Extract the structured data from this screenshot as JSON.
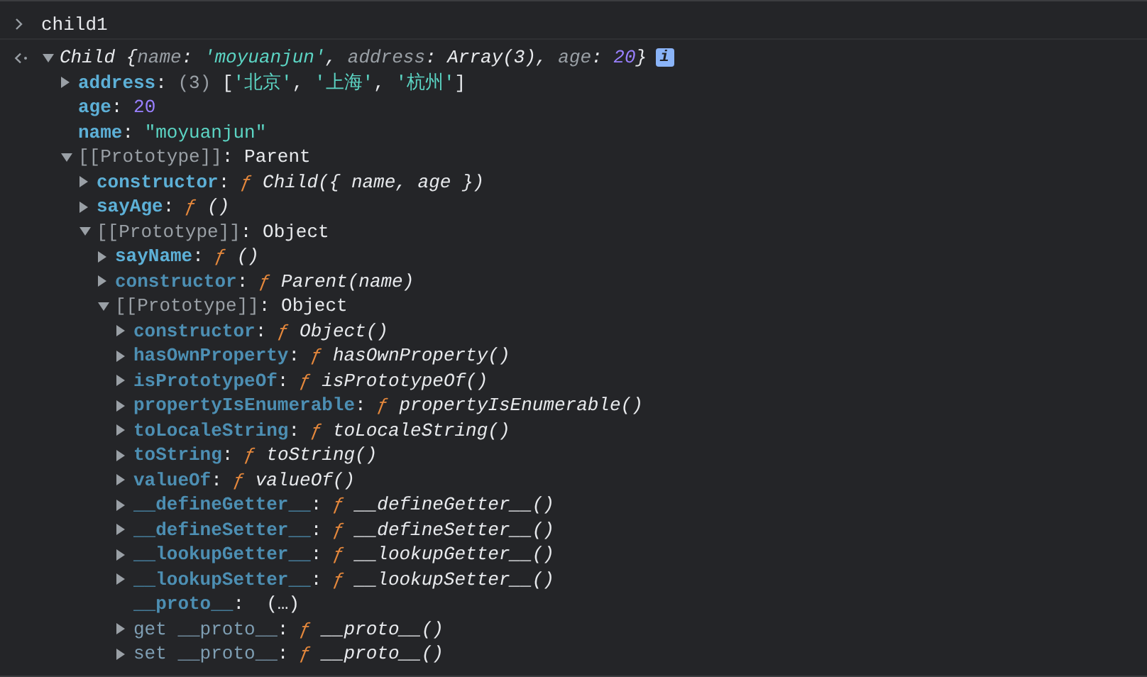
{
  "input": {
    "command": "child1"
  },
  "result": {
    "expanded": true,
    "badge": "i",
    "parts": [
      {
        "kind": "italic",
        "text": "Child "
      },
      {
        "kind": "text",
        "text": "{"
      },
      {
        "kind": "dim",
        "text": "name"
      },
      {
        "kind": "text",
        "text": ": "
      },
      {
        "kind": "string",
        "text": "'moyuanjun'"
      },
      {
        "kind": "text",
        "text": ", "
      },
      {
        "kind": "dim",
        "text": "address"
      },
      {
        "kind": "text",
        "text": ": "
      },
      {
        "kind": "italic",
        "text": "Array(3)"
      },
      {
        "kind": "text",
        "text": ", "
      },
      {
        "kind": "dim",
        "text": "age"
      },
      {
        "kind": "text",
        "text": ": "
      },
      {
        "kind": "number",
        "text": "20"
      },
      {
        "kind": "text",
        "text": "}"
      }
    ],
    "children": [
      {
        "expanded": false,
        "key": "address",
        "kind": "own",
        "parts": [
          {
            "kind": "text",
            "text": ": "
          },
          {
            "kind": "dim",
            "text": "(3) "
          },
          {
            "kind": "text",
            "text": "["
          },
          {
            "kind": "string",
            "text": "'北京'"
          },
          {
            "kind": "text",
            "text": ", "
          },
          {
            "kind": "string",
            "text": "'上海'"
          },
          {
            "kind": "text",
            "text": ", "
          },
          {
            "kind": "string",
            "text": "'杭州'"
          },
          {
            "kind": "text",
            "text": "]"
          }
        ]
      },
      {
        "key": "age",
        "kind": "own",
        "parts": [
          {
            "kind": "text",
            "text": ": "
          },
          {
            "kind": "number",
            "text": "20"
          }
        ]
      },
      {
        "key": "name",
        "kind": "own",
        "parts": [
          {
            "kind": "text",
            "text": ": "
          },
          {
            "kind": "string",
            "text": "\"moyuanjun\""
          }
        ]
      },
      {
        "expanded": true,
        "key": "[[Prototype]]",
        "kind": "internal",
        "parts": [
          {
            "kind": "text",
            "text": ": Parent"
          }
        ],
        "children": [
          {
            "expanded": false,
            "key": "constructor",
            "kind": "own",
            "parts": [
              {
                "kind": "text",
                "text": ": "
              },
              {
                "kind": "func",
                "text": "ƒ "
              },
              {
                "kind": "italic",
                "text": "Child({ name, age })"
              }
            ]
          },
          {
            "expanded": false,
            "key": "sayAge",
            "kind": "own",
            "parts": [
              {
                "kind": "text",
                "text": ": "
              },
              {
                "kind": "func",
                "text": "ƒ "
              },
              {
                "kind": "italic",
                "text": "()"
              }
            ]
          },
          {
            "expanded": true,
            "key": "[[Prototype]]",
            "kind": "internal",
            "parts": [
              {
                "kind": "text",
                "text": ": Object"
              }
            ],
            "children": [
              {
                "expanded": false,
                "key": "sayName",
                "kind": "own",
                "parts": [
                  {
                    "kind": "text",
                    "text": ": "
                  },
                  {
                    "kind": "func",
                    "text": "ƒ "
                  },
                  {
                    "kind": "italic",
                    "text": "()"
                  }
                ]
              },
              {
                "expanded": false,
                "key": "constructor",
                "kind": "inherited",
                "parts": [
                  {
                    "kind": "text",
                    "text": ": "
                  },
                  {
                    "kind": "func",
                    "text": "ƒ "
                  },
                  {
                    "kind": "italic",
                    "text": "Parent(name)"
                  }
                ]
              },
              {
                "expanded": true,
                "key": "[[Prototype]]",
                "kind": "internal",
                "parts": [
                  {
                    "kind": "text",
                    "text": ": Object"
                  }
                ],
                "children": [
                  {
                    "expanded": false,
                    "key": "constructor",
                    "kind": "inherited",
                    "parts": [
                      {
                        "kind": "text",
                        "text": ": "
                      },
                      {
                        "kind": "func",
                        "text": "ƒ "
                      },
                      {
                        "kind": "italic",
                        "text": "Object()"
                      }
                    ]
                  },
                  {
                    "expanded": false,
                    "key": "hasOwnProperty",
                    "kind": "inherited",
                    "parts": [
                      {
                        "kind": "text",
                        "text": ": "
                      },
                      {
                        "kind": "func",
                        "text": "ƒ "
                      },
                      {
                        "kind": "italic",
                        "text": "hasOwnProperty()"
                      }
                    ]
                  },
                  {
                    "expanded": false,
                    "key": "isPrototypeOf",
                    "kind": "inherited",
                    "parts": [
                      {
                        "kind": "text",
                        "text": ": "
                      },
                      {
                        "kind": "func",
                        "text": "ƒ "
                      },
                      {
                        "kind": "italic",
                        "text": "isPrototypeOf()"
                      }
                    ]
                  },
                  {
                    "expanded": false,
                    "key": "propertyIsEnumerable",
                    "kind": "inherited",
                    "parts": [
                      {
                        "kind": "text",
                        "text": ": "
                      },
                      {
                        "kind": "func",
                        "text": "ƒ "
                      },
                      {
                        "kind": "italic",
                        "text": "propertyIsEnumerable()"
                      }
                    ]
                  },
                  {
                    "expanded": false,
                    "key": "toLocaleString",
                    "kind": "inherited",
                    "parts": [
                      {
                        "kind": "text",
                        "text": ": "
                      },
                      {
                        "kind": "func",
                        "text": "ƒ "
                      },
                      {
                        "kind": "italic",
                        "text": "toLocaleString()"
                      }
                    ]
                  },
                  {
                    "expanded": false,
                    "key": "toString",
                    "kind": "inherited",
                    "parts": [
                      {
                        "kind": "text",
                        "text": ": "
                      },
                      {
                        "kind": "func",
                        "text": "ƒ "
                      },
                      {
                        "kind": "italic",
                        "text": "toString()"
                      }
                    ]
                  },
                  {
                    "expanded": false,
                    "key": "valueOf",
                    "kind": "inherited",
                    "parts": [
                      {
                        "kind": "text",
                        "text": ": "
                      },
                      {
                        "kind": "func",
                        "text": "ƒ "
                      },
                      {
                        "kind": "italic",
                        "text": "valueOf()"
                      }
                    ]
                  },
                  {
                    "expanded": false,
                    "key": "__defineGetter__",
                    "kind": "inherited",
                    "parts": [
                      {
                        "kind": "text",
                        "text": ": "
                      },
                      {
                        "kind": "func",
                        "text": "ƒ "
                      },
                      {
                        "kind": "italic",
                        "text": "__defineGetter__()"
                      }
                    ]
                  },
                  {
                    "expanded": false,
                    "key": "__defineSetter__",
                    "kind": "inherited",
                    "parts": [
                      {
                        "kind": "text",
                        "text": ": "
                      },
                      {
                        "kind": "func",
                        "text": "ƒ "
                      },
                      {
                        "kind": "italic",
                        "text": "__defineSetter__()"
                      }
                    ]
                  },
                  {
                    "expanded": false,
                    "key": "__lookupGetter__",
                    "kind": "inherited",
                    "parts": [
                      {
                        "kind": "text",
                        "text": ": "
                      },
                      {
                        "kind": "func",
                        "text": "ƒ "
                      },
                      {
                        "kind": "italic",
                        "text": "__lookupGetter__()"
                      }
                    ]
                  },
                  {
                    "expanded": false,
                    "key": "__lookupSetter__",
                    "kind": "inherited",
                    "parts": [
                      {
                        "kind": "text",
                        "text": ": "
                      },
                      {
                        "kind": "func",
                        "text": "ƒ "
                      },
                      {
                        "kind": "italic",
                        "text": "__lookupSetter__()"
                      }
                    ]
                  },
                  {
                    "key": "__proto__",
                    "kind": "inherited",
                    "parts": [
                      {
                        "kind": "text",
                        "text": ":  (…)"
                      }
                    ]
                  },
                  {
                    "expanded": false,
                    "key": "get __proto__",
                    "kind": "accessor",
                    "parts": [
                      {
                        "kind": "text",
                        "text": ": "
                      },
                      {
                        "kind": "func",
                        "text": "ƒ "
                      },
                      {
                        "kind": "italic",
                        "text": "__proto__()"
                      }
                    ]
                  },
                  {
                    "expanded": false,
                    "key": "set __proto__",
                    "kind": "accessor",
                    "parts": [
                      {
                        "kind": "text",
                        "text": ": "
                      },
                      {
                        "kind": "func",
                        "text": "ƒ "
                      },
                      {
                        "kind": "italic",
                        "text": "__proto__()"
                      }
                    ]
                  }
                ]
              }
            ]
          }
        ]
      }
    ]
  }
}
